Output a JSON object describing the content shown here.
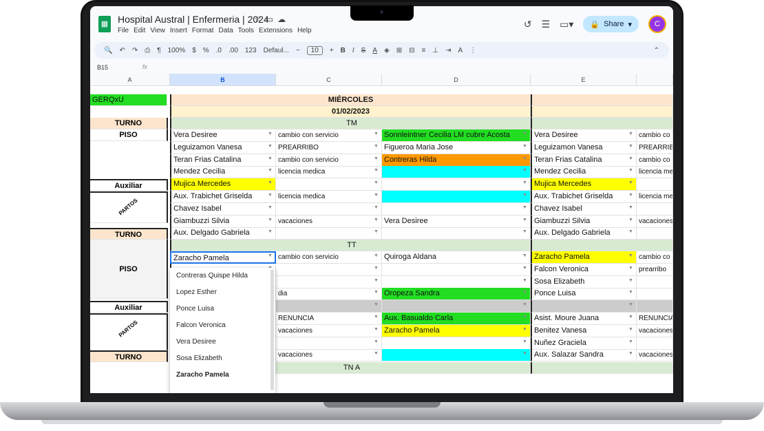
{
  "app": {
    "title": "Hospital Austral | Enfermeria | 2024",
    "menus": [
      "File",
      "Edit",
      "View",
      "Insert",
      "Format",
      "Data",
      "Tools",
      "Extensions",
      "Help"
    ],
    "share_label": "Share",
    "avatar_letter": "C"
  },
  "toolbar": {
    "zoom": "100%",
    "currency": "$",
    "percent": "%",
    "dec_less": ".0",
    "dec_more": ".00",
    "num_format": "123",
    "font": "Defaul...",
    "font_size": "10",
    "bold": "B",
    "italic": "I",
    "strike": "S",
    "text_color": "A"
  },
  "formula_bar": {
    "cell_ref": "B15",
    "fx": "fx"
  },
  "columns": [
    "A",
    "B",
    "C",
    "D",
    "E"
  ],
  "sheet": {
    "a_header": "GERQxU",
    "day": "MIÉRCOLES",
    "date": "01/02/2023",
    "shift_tm": "TM",
    "shift_tt": "TT",
    "shift_tna": "TN A",
    "labels": {
      "turno1": "TURNO",
      "piso1": "PISO",
      "auxiliar1": "Auxiliar",
      "partos1": "PARTOS",
      "turno2": "TURNO",
      "piso2": "PISO",
      "auxiliar2": "Auxiliar",
      "partos2": "PARTOS",
      "turno3": "TURNO"
    },
    "rows_tm": [
      {
        "b": "Vera Desiree",
        "c": "cambio con servicio",
        "d": "Sonnleintner Cecilia LM cubre Acosta",
        "e": "Vera Desiree",
        "f": "cambio co"
      },
      {
        "b": "Leguizamon Vanesa",
        "c": "PREARRIBO",
        "d": "Figueroa Maria Jose",
        "e": "Leguizamon Vanesa",
        "f": "PREARRIB"
      },
      {
        "b": "Teran Frias Catalina",
        "c": "cambio con servicio",
        "d": "Contreras  Hilda",
        "e": "Teran Frias Catalina",
        "f": "cambio co"
      },
      {
        "b": "Mendez Cecilia",
        "c": "licencia medica",
        "d": "",
        "e": "Mendez Cecilia",
        "f": "licencia me"
      },
      {
        "b": "Mujica Mercedes",
        "c": "",
        "d": "",
        "e": "Mujica Mercedes",
        "f": ""
      },
      {
        "b": "Aux. Trabichet Griselda",
        "c": "licencia medica",
        "d": "",
        "e": "Aux. Trabichet Griselda",
        "f": "licencia me"
      },
      {
        "b": "Chavez Isabel",
        "c": "",
        "d": "",
        "e": "Chavez Isabel",
        "f": ""
      },
      {
        "b": "Giambuzzi Silvia",
        "c": "vacaciones",
        "d": "Vera Desiree",
        "e": "Giambuzzi Silvia",
        "f": "vacaciones"
      },
      {
        "b": "Aux. Delgado Gabriela",
        "c": "",
        "d": "",
        "e": "Aux. Delgado Gabriela",
        "f": ""
      }
    ],
    "rows_tt": [
      {
        "b": "Zaracho Pamela",
        "c": "cambio con servicio",
        "d": "Quiroga Aldana",
        "e": "Zaracho Pamela",
        "f": "cambio co"
      },
      {
        "b": "",
        "c": "",
        "d": "",
        "e": "Falcon Veronica",
        "f": "prearribo"
      },
      {
        "b": "",
        "c": "",
        "d": "",
        "e": "Sosa Elizabeth",
        "f": ""
      },
      {
        "b": "",
        "c": "dia",
        "d": "Oropeza  Sandra",
        "e": "Ponce Luisa",
        "f": ""
      },
      {
        "b": "",
        "c": "",
        "d": "",
        "e": "",
        "f": ""
      },
      {
        "b": "",
        "c": "RENUNCIA",
        "d": "Aux. Basualdo Carla",
        "e": "Asist. Moure Juana",
        "f": "RENUNCIA"
      },
      {
        "b": "",
        "c": "vacaciones",
        "d": "Zaracho Pamela",
        "e": "Benitez Vanesa",
        "f": "vacaciones"
      },
      {
        "b": "",
        "c": "",
        "d": "",
        "e": "Nuñez Graciela",
        "f": ""
      },
      {
        "b": "",
        "c": "vacaciones",
        "d": "",
        "e": "Aux. Salazar Sandra",
        "f": "vacaciones"
      }
    ],
    "dropdown_options": [
      "Contreras Quispe Hilda",
      "Lopez Esther",
      "Ponce Luisa",
      "Falcon Veronica",
      "Vera Desiree",
      "Sosa Elizabeth",
      "Zaracho Pamela"
    ],
    "colors": {
      "green": "#22dd22",
      "yellow": "#ffff00",
      "cyan": "#00ffff",
      "orange": "#ff9900",
      "peach": "#fde5cd",
      "lightgreen": "#d9ead3",
      "cream": "#fff2cc",
      "gray": "#cccccc"
    }
  }
}
